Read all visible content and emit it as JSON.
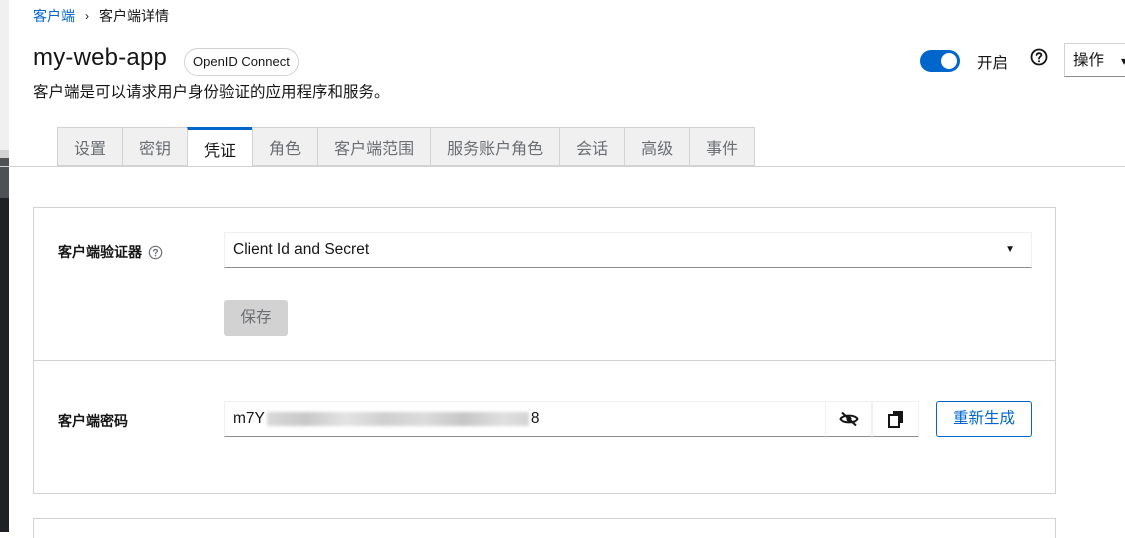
{
  "breadcrumb": {
    "parent": "客户端",
    "current": "客户端详情"
  },
  "header": {
    "title": "my-web-app",
    "protocol_badge": "OpenID Connect",
    "subtitle": "客户端是可以请求用户身份验证的应用程序和服务。",
    "enabled_label": "开启",
    "enabled": true,
    "action_label": "操作"
  },
  "tabs": [
    {
      "label": "设置"
    },
    {
      "label": "密钥"
    },
    {
      "label": "凭证",
      "active": true
    },
    {
      "label": "角色"
    },
    {
      "label": "客户端范围"
    },
    {
      "label": "服务账户角色"
    },
    {
      "label": "会话"
    },
    {
      "label": "高级"
    },
    {
      "label": "事件"
    }
  ],
  "authenticator": {
    "label": "客户端验证器",
    "value": "Client Id and Secret",
    "save_label": "保存"
  },
  "secret": {
    "label": "客户端密码",
    "value_prefix": "m7Y",
    "value_suffix": "8",
    "regenerate_label": "重新生成"
  },
  "colors": {
    "accent": "#0066cc",
    "border": "#d2d2d2"
  }
}
